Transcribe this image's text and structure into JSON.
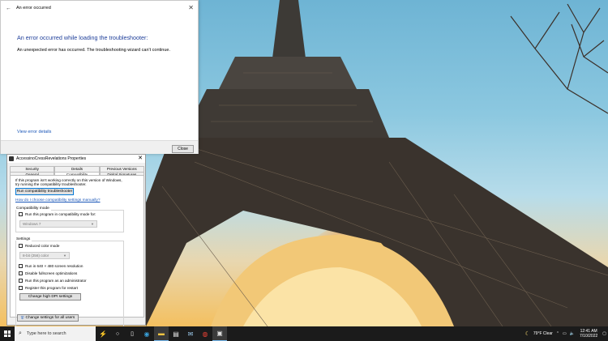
{
  "error_dialog": {
    "title": "An error occurred",
    "heading": "An error occurred while loading the troubleshooter:",
    "message": "An unexpected error has occurred. The troubleshooting wizard can't continue.",
    "details_link": "View error details",
    "close_label": "Close"
  },
  "props_dialog": {
    "title": "AccessinoCressRevelations Properties",
    "tabs_row1": [
      "Security",
      "Details",
      "Previous Versions"
    ],
    "tabs_row2": [
      "General",
      "Compatibility",
      "Digital Signatures"
    ],
    "active_tab": "Compatibility",
    "description_line1": "If this program isn't working correctly on this version of Windows,",
    "description_line2": "try running the compatibility troubleshooter.",
    "run_troubleshooter_label": "Run compatibility troubleshooter",
    "manual_link": "How do I choose compatibility settings manually?",
    "compat_mode_group": "Compatibility mode",
    "compat_mode_checkbox": "Run this program in compatibility mode for:",
    "compat_mode_value": "Windows 7",
    "settings_group": "Settings",
    "settings_items": {
      "reduced_color": "Reduced color mode",
      "color_value": "8-bit (256) color",
      "res_640": "Run in 640 × 480 screen resolution",
      "disable_fullscreen": "Disable fullscreen optimizations",
      "admin": "Run this program as an administrator",
      "register_restart": "Register this program for restart"
    },
    "dpi_button": "Change high DPI settings",
    "all_users_button": "Change settings for all users"
  },
  "taskbar": {
    "search_placeholder": "Type here to search",
    "weather": "79°F  Clear",
    "time": "12:41 AM",
    "date": "7/10/2022"
  }
}
